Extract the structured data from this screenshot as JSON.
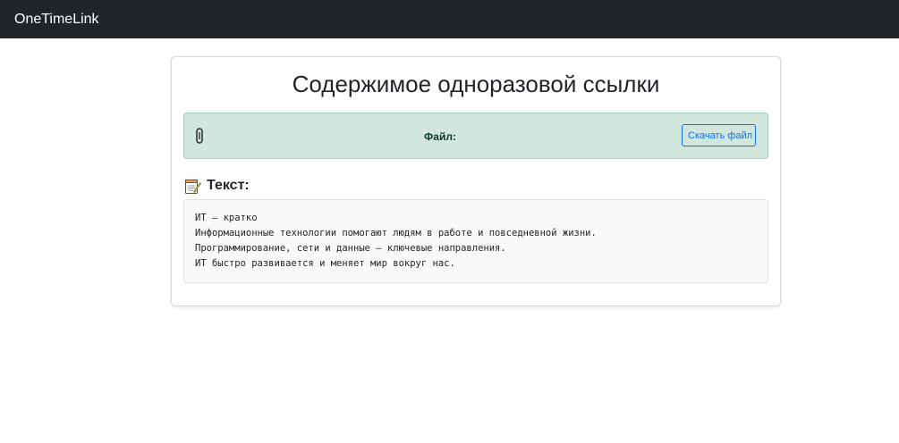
{
  "navbar": {
    "brand": "OneTimeLink"
  },
  "card": {
    "title": "Содержимое одноразовой ссылки",
    "file_section": {
      "icon": "paperclip-icon",
      "label": "Файл:",
      "download_label": "Скачать файл"
    },
    "text_section": {
      "icon": "memo-icon",
      "heading": "Текст:",
      "lines": [
        "ИТ – кратко",
        "Информационные технологии помогают людям в работе и повседневной жизни.",
        "Программирование, сети и данные — ключевые направления.",
        "ИТ быстро развивается и меняет мир вокруг нас."
      ]
    }
  }
}
